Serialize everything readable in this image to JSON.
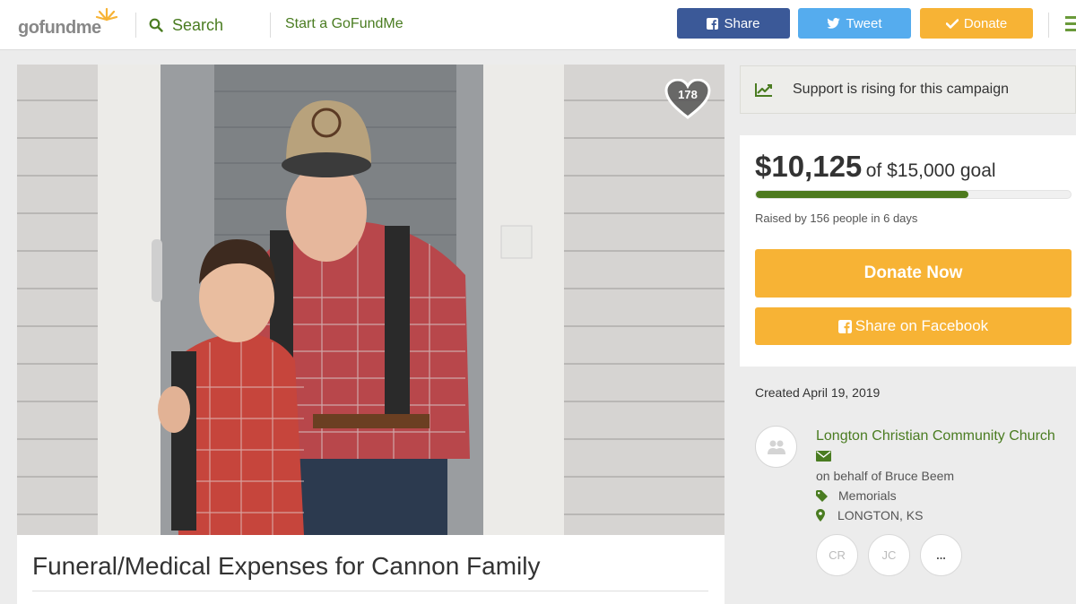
{
  "header": {
    "logo_text": "gofundme",
    "search_label": "Search",
    "start_label": "Start a GoFundMe",
    "share_label": "Share",
    "tweet_label": "Tweet",
    "donate_label": "Donate",
    "colors": {
      "facebook": "#3b5998",
      "twitter": "#55acee",
      "donate": "#f7b335",
      "brand_green": "#4a7c21"
    }
  },
  "campaign": {
    "heart_count": "178",
    "title": "Funeral/Medical Expenses for Cannon Family"
  },
  "sidebar": {
    "rising_text": "Support is rising for this campaign",
    "raised_amount": "$10,125",
    "raised_goal": "of $15,000 goal",
    "progress_fraction": 0.675,
    "raised_by": "Raised by 156 people in 6 days",
    "donate_now_label": "Donate Now",
    "share_facebook_label": "Share on Facebook",
    "created": "Created April 19, 2019",
    "organizer": "Longton Christian Community Church",
    "on_behalf": "on behalf of Bruce Beem",
    "category": "Memorials",
    "location": "LONGTON, KS",
    "team": [
      "CR",
      "JC",
      "..."
    ]
  }
}
